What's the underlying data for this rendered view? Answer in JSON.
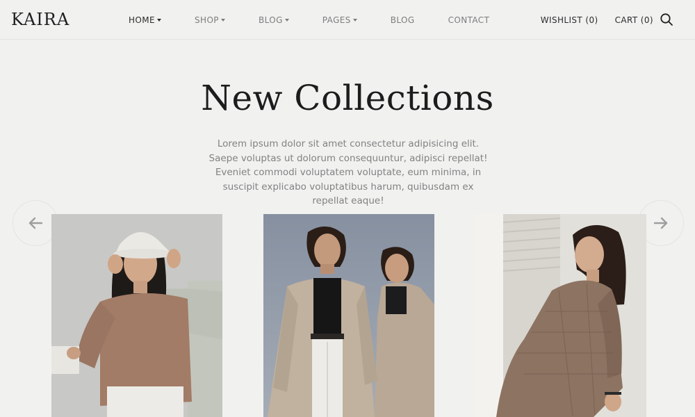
{
  "brand": {
    "logo": "KAIRA"
  },
  "nav": {
    "items": [
      {
        "label": "HOME",
        "has_dropdown": true,
        "active": true
      },
      {
        "label": "SHOP",
        "has_dropdown": true,
        "active": false
      },
      {
        "label": "BLOG",
        "has_dropdown": true,
        "active": false
      },
      {
        "label": "PAGES",
        "has_dropdown": true,
        "active": false
      },
      {
        "label": "BLOG",
        "has_dropdown": false,
        "active": false
      },
      {
        "label": "CONTACT",
        "has_dropdown": false,
        "active": false
      }
    ]
  },
  "header_right": {
    "wishlist_label": "WISHLIST (0)",
    "cart_label": "CART (0)",
    "search_icon": "search-icon"
  },
  "hero": {
    "title": "New Collections",
    "description": "Lorem ipsum dolor sit amet consectetur adipisicing elit. Saepe voluptas ut dolorum consequuntur, adipisci repellat! Eveniet commodi voluptatem voluptate, eum minima, in suscipit explicabo voluptatibus harum, quibusdam ex repellat eaque!"
  },
  "carousel": {
    "prev_icon": "arrow-left-icon",
    "next_icon": "arrow-right-icon",
    "cards": [
      {
        "image": "woman-bucket-hat-photo"
      },
      {
        "image": "two-women-trench-coats-photo"
      },
      {
        "image": "woman-plaid-blazer-photo"
      }
    ]
  },
  "colors": {
    "background": "#f1f1f0",
    "text_dark": "#1c1c1c",
    "text_muted": "#828282",
    "nav_muted": "#7d7d7d"
  }
}
